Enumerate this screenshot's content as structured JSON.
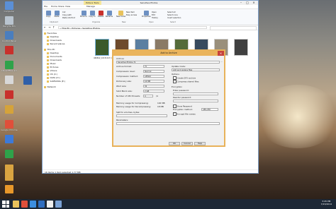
{
  "desktop": {
    "icons": [
      {
        "label": "Computer",
        "color": "#5b8fd6"
      },
      {
        "label": "Recycle Bin",
        "color": "#b9c4cf"
      },
      {
        "label": "Control Panel",
        "color": "#4a7ebe"
      },
      {
        "label": "",
        "color": "#c8302c"
      },
      {
        "label": "LibreOffice 4.1",
        "color": "#2fa24a"
      },
      {
        "label": "",
        "color": "#d8d8d8"
      },
      {
        "label": "",
        "color": "#c8302c"
      },
      {
        "label": "",
        "color": "#d5a33a"
      },
      {
        "label": "Google Chrome",
        "color": "#e04f3a"
      },
      {
        "label": "",
        "color": "#3d7ad9"
      },
      {
        "label": "",
        "color": "#2fa24a"
      },
      {
        "label": "",
        "color": "#d9a441"
      },
      {
        "label": "",
        "color": "#2f5fa8"
      },
      {
        "label": "",
        "color": "#d9a441"
      },
      {
        "label": "",
        "color": "#e8982a"
      }
    ]
  },
  "explorer": {
    "title": "Sensitive Photos",
    "context_tab": "Picture Tools",
    "menu": [
      "File",
      "Home",
      "Share",
      "View",
      "Manage"
    ],
    "ribbon": {
      "buttons": [
        "Copy",
        "Paste",
        "Move to",
        "Copy to",
        "Delete",
        "Rename",
        "New folder",
        "Properties"
      ],
      "small": [
        "Cut",
        "Copy path",
        "Paste shortcut",
        "New item",
        "Easy access",
        "Open",
        "Edit",
        "History",
        "Select all",
        "Select none",
        "Invert selection"
      ],
      "groups": [
        "Clipboard",
        "Organize",
        "New",
        "Open",
        "Select"
      ]
    },
    "address": "› This PC › Pictures › Sensitive Photos",
    "nav": [
      "Favorites",
      "Desktop",
      "Downloads",
      "Recent places",
      "This PC",
      "Desktop",
      "Documents",
      "Downloads",
      "Music",
      "Pictures",
      "Videos",
      "OS (C:)",
      "DATA (D:)",
      "SAMSUNG (E:)",
      "Network"
    ],
    "thumbnails": [
      {
        "caption": "466842_10151017 (1)",
        "color": "#3a5a2a"
      },
      {
        "caption": "",
        "color": "#6e4a2c"
      },
      {
        "caption": "",
        "color": "#5b7fa1"
      },
      {
        "caption": "",
        "color": "#8a7a66"
      },
      {
        "caption": "",
        "color": "#556b3a"
      },
      {
        "caption": "",
        "color": "#374a5e"
      },
      {
        "caption": "",
        "color": "#9a8f7b"
      },
      {
        "caption": "",
        "color": "#404040"
      }
    ],
    "status": "16 items   1 item selected  1.77 MB"
  },
  "archive_dialog": {
    "title": "Add to Archive",
    "archive_label": "Archive:",
    "archive_value": "Sensitive Photos.7z",
    "format_label": "Archive format:",
    "format_value": "7z",
    "level_label": "Compression level:",
    "level_value": "Normal",
    "method_label": "Compression method:",
    "method_value": "LZMA2",
    "dict_label": "Dictionary size:",
    "dict_value": "16 MB",
    "word_label": "Word size:",
    "word_value": "32",
    "solid_label": "Solid Block size:",
    "solid_value": "2 GB",
    "threads_label": "Number of CPU threads:",
    "threads_value": "4",
    "threads_of": "/4",
    "mem_comp_label": "Memory usage for Compressing:",
    "mem_comp_value": "192 MB",
    "mem_decomp_label": "Memory usage for Decompressing:",
    "mem_decomp_value": "18 MB",
    "split_label": "Split to volumes, bytes:",
    "params_label": "Parameters:",
    "update_label": "Update mode:",
    "update_value": "Add and replace files",
    "options_label": "Options",
    "opt_sfx": "Create SFX archive",
    "opt_shared": "Compress shared files",
    "encryption_label": "Encryption",
    "enter_pw_label": "Enter password:",
    "reenter_pw_label": "Reenter password:",
    "show_pw": "Show Password",
    "enc_method_label": "Encryption method:",
    "enc_method_value": "AES-256",
    "encrypt_names": "Encrypt file names",
    "ok": "OK",
    "cancel": "Cancel",
    "help": "Help"
  },
  "taskbar": {
    "time": "3:45 PM",
    "date": "7/23/2014",
    "apps": [
      {
        "name": "file-explorer",
        "color": "#e8c25c"
      },
      {
        "name": "chrome",
        "color": "#e04f3a"
      },
      {
        "name": "ie",
        "color": "#3b8ee0"
      },
      {
        "name": "outlook",
        "color": "#2f6ec0"
      },
      {
        "name": "7zip",
        "color": "#eeeeee"
      },
      {
        "name": "app6",
        "color": "#7aa2d6"
      }
    ]
  }
}
